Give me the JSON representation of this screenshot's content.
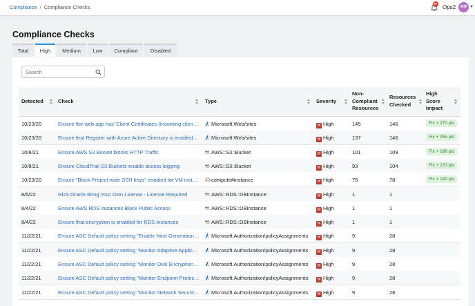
{
  "breadcrumb": {
    "root": "Compliance",
    "separator": "/",
    "current": "Compliance Checks"
  },
  "header": {
    "notification_count": "9+",
    "org_name": "Ops2",
    "avatar_initials": "MM"
  },
  "page": {
    "title": "Compliance Checks"
  },
  "tabs": [
    {
      "label": "Total",
      "active": false
    },
    {
      "label": "High",
      "active": true
    },
    {
      "label": "Medium",
      "active": false
    },
    {
      "label": "Low",
      "active": false
    },
    {
      "label": "Compliant",
      "active": false
    },
    {
      "label": "Disabled",
      "active": false
    }
  ],
  "search": {
    "placeholder": "Search",
    "value": ""
  },
  "table": {
    "headers": {
      "detected": "Detected",
      "check": "Check",
      "type": "Type",
      "severity": "Severity",
      "non_compliant_1": "Non-",
      "non_compliant_2": "Compliant",
      "non_compliant_3": "Resources",
      "resources_checked_1": "Resources",
      "resources_checked_2": "Checked",
      "high_score_1": "High",
      "high_score_2": "Score",
      "high_score_3": "Impact"
    },
    "severity_badge": "H",
    "rows": [
      {
        "detected": "10/23/20",
        "check": "Ensure the web app has 'Client Certificates (Incoming client certificates)' set to 'On'",
        "type_icon": "azure-icon",
        "type": "Microsoft.Web/sites",
        "severity": "High",
        "non_compliant": "145",
        "checked": "146",
        "impact": "Fix + 270 pts"
      },
      {
        "detected": "10/23/20",
        "check": "Ensure that Register with Azure Active Directory is enabled on App Service",
        "type_icon": "azure-icon",
        "type": "Microsoft.Web/sites",
        "severity": "High",
        "non_compliant": "137",
        "checked": "146",
        "impact": "Fix + 255 pts"
      },
      {
        "detected": "10/8/21",
        "check": "Ensure AWS S3 Bucket blocks HTTP Traffic",
        "type_icon": "aws-icon",
        "type": "AWS::S3::Bucket",
        "severity": "High",
        "non_compliant": "101",
        "checked": "109",
        "impact": "Fix + 188 pts"
      },
      {
        "detected": "10/8/21",
        "check": "Ensure CloudTrail S3 Buckets enable access logging",
        "type_icon": "aws-icon",
        "type": "AWS::S3::Bucket",
        "severity": "High",
        "non_compliant": "93",
        "checked": "104",
        "impact": "Fix + 173 pts"
      },
      {
        "detected": "10/23/20",
        "check": "Ensure \"Block Project-wide SSH keys\" enabled for VM instances",
        "type_icon": "gcp-icon",
        "type": "compute#instance",
        "severity": "High",
        "non_compliant": "75",
        "checked": "78",
        "impact": "Fix + 140 pts"
      },
      {
        "detected": "8/5/22",
        "check": "RDS Oracle Bring Your Own License - License Required",
        "type_icon": "aws-icon",
        "type": "AWS::RDS::DBInstance",
        "severity": "High",
        "non_compliant": "1",
        "checked": "1",
        "impact": ""
      },
      {
        "detected": "8/4/22",
        "check": "Ensure AWS RDS Instances Block Public Access",
        "type_icon": "aws-icon",
        "type": "AWS::RDS::DBInstance",
        "severity": "High",
        "non_compliant": "1",
        "checked": "1",
        "impact": ""
      },
      {
        "detected": "8/4/22",
        "check": "Ensure that encryption is enabled for RDS Instances",
        "type_icon": "aws-icon",
        "type": "AWS::RDS::DBInstance",
        "severity": "High",
        "non_compliant": "1",
        "checked": "1",
        "impact": ""
      },
      {
        "detected": "11/22/21",
        "check": "Ensure ASC Default policy setting \"Enable Next Generation Firewall (NGFW) Monitoring\" is not \"Disabled\"",
        "type_icon": "azure-icon",
        "type": "Microsoft.Authorization/policyAssignments",
        "severity": "High",
        "non_compliant": "9",
        "checked": "28",
        "impact": ""
      },
      {
        "detected": "11/22/21",
        "check": "Ensure ASC Default policy setting \"Monitor Adaptive Application Whitelisting\" is not \"Disabled\"",
        "type_icon": "azure-icon",
        "type": "Microsoft.Authorization/policyAssignments",
        "severity": "High",
        "non_compliant": "9",
        "checked": "28",
        "impact": ""
      },
      {
        "detected": "11/22/21",
        "check": "Ensure ASC Default policy setting \"Monitor Disk Encryption\" is not \"Disabled\"",
        "type_icon": "azure-icon",
        "type": "Microsoft.Authorization/policyAssignments",
        "severity": "High",
        "non_compliant": "9",
        "checked": "28",
        "impact": ""
      },
      {
        "detected": "11/22/21",
        "check": "Ensure ASC Default policy setting \"Monitor Endpoint Protection\" is not \"Disabled\"",
        "type_icon": "azure-icon",
        "type": "Microsoft.Authorization/policyAssignments",
        "severity": "High",
        "non_compliant": "9",
        "checked": "28",
        "impact": ""
      },
      {
        "detected": "11/22/21",
        "check": "Ensure ASC Default policy setting \"Monitor Network Security Groups\" is not \"Disabled\"",
        "type_icon": "azure-icon",
        "type": "Microsoft.Authorization/policyAssignments",
        "severity": "High",
        "non_compliant": "9",
        "checked": "28",
        "impact": ""
      }
    ]
  },
  "colors": {
    "accent": "#2b8ed9",
    "link": "#2b6cc4",
    "high": "#c0392b",
    "pill_bg": "#dff3df",
    "pill_text": "#2d7d32",
    "avatar": "#b270c9"
  }
}
